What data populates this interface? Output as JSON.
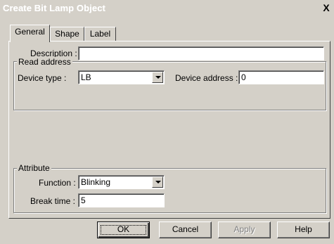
{
  "window": {
    "title": "Create Bit Lamp Object",
    "close_glyph": "X"
  },
  "tabs": [
    {
      "label": "General",
      "active": true
    },
    {
      "label": "Shape",
      "active": false
    },
    {
      "label": "Label",
      "active": false
    }
  ],
  "general": {
    "description_label": "Description :",
    "description_value": "",
    "read_address": {
      "title": "Read address",
      "device_type_label": "Device type :",
      "device_type_value": "LB",
      "device_address_label": "Device address :",
      "device_address_value": "0"
    },
    "attribute": {
      "title": "Attribute",
      "function_label": "Function :",
      "function_value": "Blinking",
      "break_time_label": "Break time :",
      "break_time_value": "5"
    }
  },
  "buttons": {
    "ok": "OK",
    "cancel": "Cancel",
    "apply": "Apply",
    "help": "Help"
  },
  "colors": {
    "face": "#d4d0c8",
    "field": "#ffffff",
    "disabled_text": "#808080"
  }
}
